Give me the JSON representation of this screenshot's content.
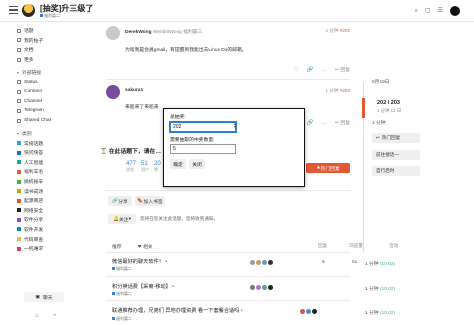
{
  "header": {
    "title": "[抽奖]升三级了",
    "category": "福利篇二",
    "icons": [
      "search-icon",
      "bell-icon",
      "menu-icon",
      "user-avatar"
    ]
  },
  "sidebar": {
    "items": [
      {
        "label": "话题",
        "icon": "topics-icon"
      },
      {
        "label": "我的帖子",
        "icon": "user-icon"
      },
      {
        "label": "文档",
        "icon": "doc-icon"
      },
      {
        "label": "更多",
        "icon": "more-icon"
      }
    ],
    "external_head": "外部链接",
    "external": [
      {
        "label": "Status"
      },
      {
        "label": "Connect"
      },
      {
        "label": "Channel"
      },
      {
        "label": "Telegram"
      },
      {
        "label": "Shared Chat"
      }
    ],
    "categories_head": "类别",
    "categories": [
      {
        "label": "常规话题",
        "color": "#25aae1"
      },
      {
        "label": "快问快答",
        "color": "#0e76bd"
      },
      {
        "label": "人工智能",
        "color": "#12a89d"
      },
      {
        "label": "福利羊毛",
        "color": "#f1592a"
      },
      {
        "label": "搞机秘辛",
        "color": "#3ab54a"
      },
      {
        "label": "读书成诗",
        "color": "#c4a800"
      },
      {
        "label": "起源商店",
        "color": "#e45735"
      },
      {
        "label": "网络安全",
        "color": "#231f20"
      },
      {
        "label": "软件分享",
        "color": "#9a42d5"
      },
      {
        "label": "软件开发",
        "color": "#0088cc"
      },
      {
        "label": "代码审查",
        "color": "#f0bf47"
      },
      {
        "label": "一机难求",
        "color": "#e8345e"
      }
    ],
    "chat_button": "聊天"
  },
  "posts": [
    {
      "author": "DerekWong",
      "author_sub": "WenbotWong 福利篇三",
      "time": "2 分钟",
      "id": "#202",
      "body": "为啥我是会員gmail，有提醒到我能出去Linux Do的邮箱。",
      "reply": "回复"
    },
    {
      "author": "sakura1",
      "time": "1 分钟",
      "id": "#203",
      "body": "来船来了来船来",
      "reply": "回复"
    }
  ],
  "footer": {
    "title": "在此话题下，请在…",
    "stats": [
      {
        "num": "477",
        "label": "浏览"
      },
      {
        "num": "51",
        "label": "用户"
      },
      {
        "num": "20",
        "label": "赞"
      }
    ],
    "hot_button": "热门回复",
    "share_button": "分享",
    "bookmark_button": "加入书签",
    "notify_button": "关注",
    "notify_text": "您将在您关注此话题，您将收到通知。"
  },
  "topic_list": {
    "tabs": [
      "推荐",
      "相关"
    ],
    "headers": {
      "replies": "回复",
      "views": "浏览量",
      "activity": "活动"
    },
    "rows": [
      {
        "title": "微信最好的聊天软件！",
        "category": "福利篇二",
        "replies": "6",
        "views": "51",
        "date": "1 分钟",
        "date_extra": "(10.02)"
      },
      {
        "title": "积分换话费【采菊·移动】",
        "category": "福利篇二",
        "replies": "",
        "views": "",
        "date": "1 分钟",
        "date_extra": "(10.02)"
      },
      {
        "title": "联通推荐办理，兄弟们 异地办理资费 看一下套餐合适吗",
        "category": "福利篇二",
        "replies": "",
        "views": "",
        "date": "1 分钟",
        "date_extra": "(10.02)"
      }
    ]
  },
  "right": {
    "date_top": "9月19日",
    "count": "202 / 203",
    "count_sub": "1 分钟 14 日",
    "date_bottom": "1 分钟",
    "hot_reply": "热门回复",
    "btn2": "前往搜话一",
    "btn3": "自行启时"
  },
  "modal": {
    "label1": "总抽奖:",
    "value1": "202",
    "label2": "需要抽取的中奖数量:",
    "value2": "5",
    "confirm": "确定",
    "close": "关闭"
  }
}
